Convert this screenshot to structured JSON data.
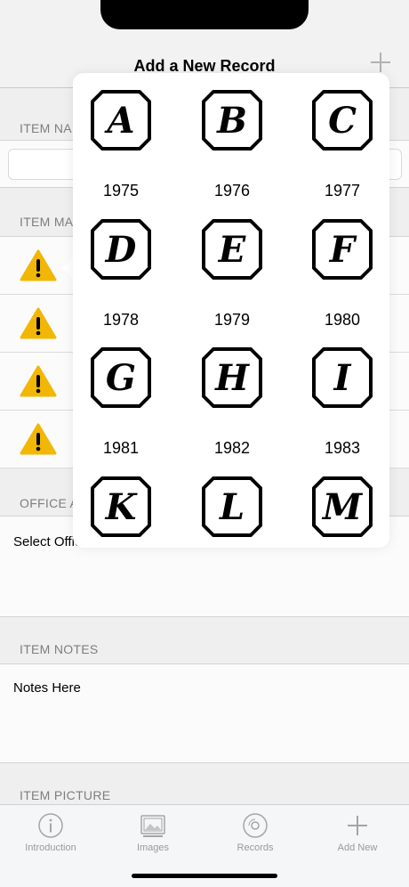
{
  "nav": {
    "title": "Add a New Record"
  },
  "sections": {
    "item_name": "ITEM NAME",
    "item_mark": "ITEM MARK",
    "office": "OFFICE ASSAY",
    "notes": "ITEM NOTES",
    "picture": "ITEM PICTURE"
  },
  "fields": {
    "office_value": "Select Office",
    "notes_value": "Notes Here"
  },
  "picker": {
    "marks": [
      {
        "letter": "A",
        "year": "1975"
      },
      {
        "letter": "B",
        "year": "1976"
      },
      {
        "letter": "C",
        "year": "1977"
      },
      {
        "letter": "D",
        "year": "1978"
      },
      {
        "letter": "E",
        "year": "1979"
      },
      {
        "letter": "F",
        "year": "1980"
      },
      {
        "letter": "G",
        "year": "1981"
      },
      {
        "letter": "H",
        "year": "1982"
      },
      {
        "letter": "I",
        "year": "1983"
      },
      {
        "letter": "K",
        "year": ""
      },
      {
        "letter": "L",
        "year": ""
      },
      {
        "letter": "M",
        "year": ""
      }
    ]
  },
  "tabs": [
    {
      "label": "Introduction",
      "icon": "info-icon"
    },
    {
      "label": "Images",
      "icon": "images-icon"
    },
    {
      "label": "Records",
      "icon": "records-icon"
    },
    {
      "label": "Add New",
      "icon": "plus-icon"
    }
  ],
  "colors": {
    "warning": "#f2b705",
    "tab_inactive": "#9a9a9a"
  }
}
